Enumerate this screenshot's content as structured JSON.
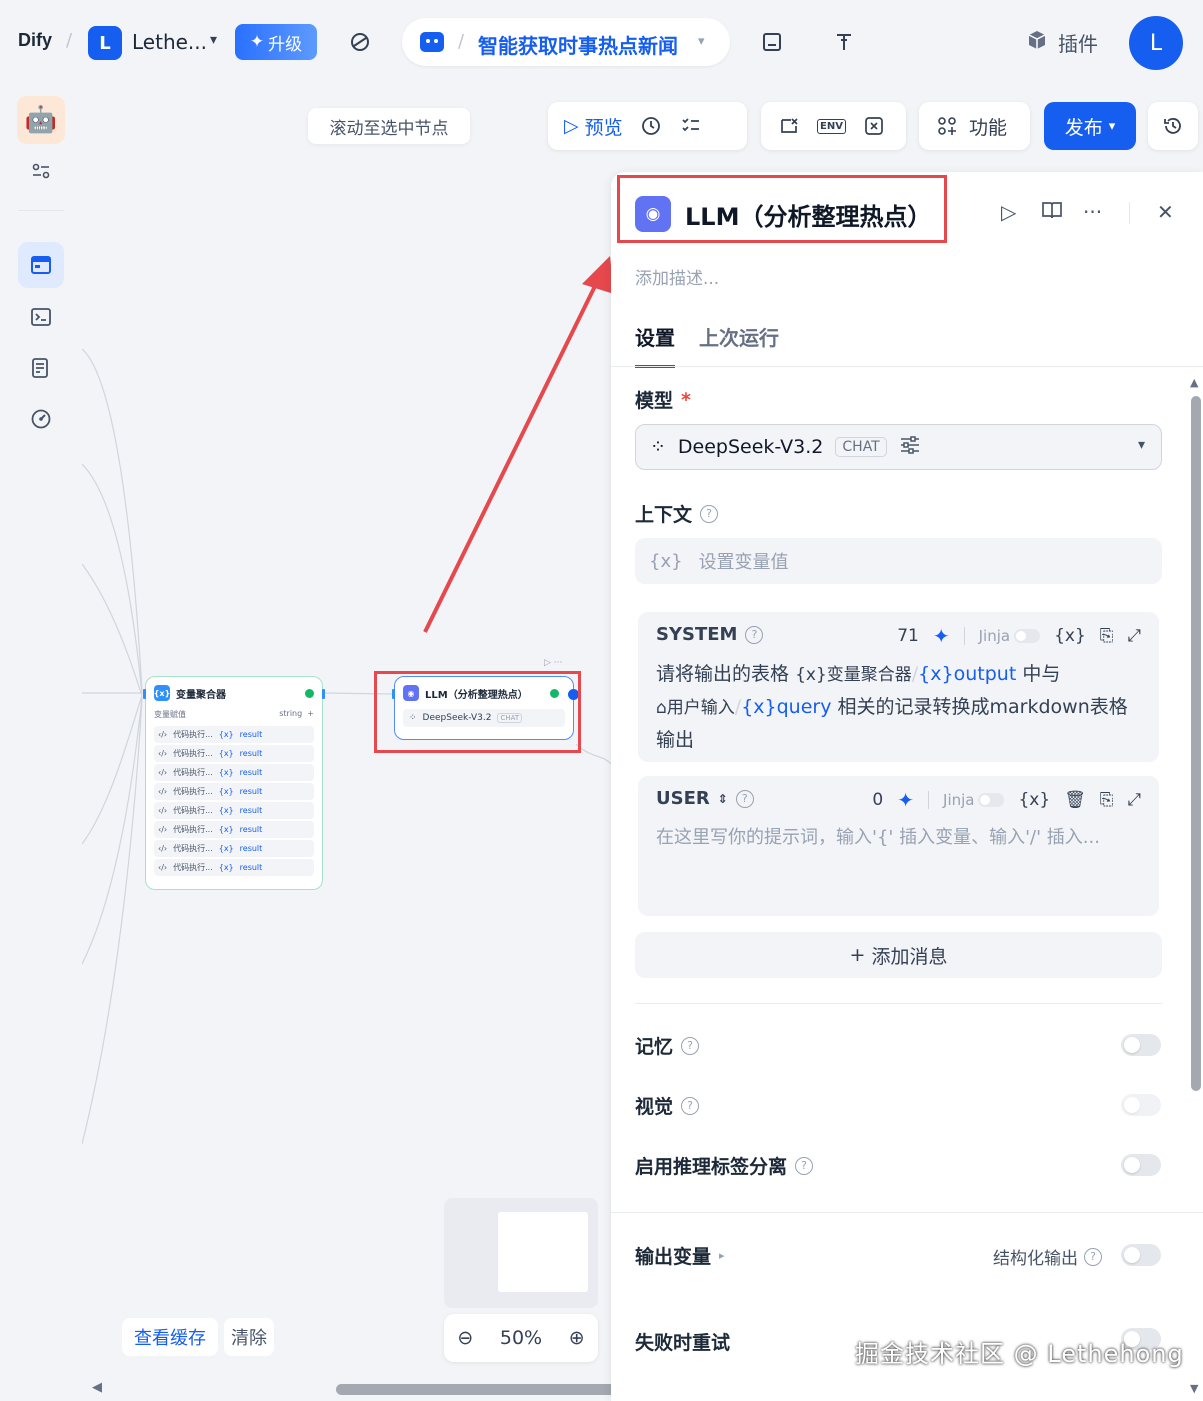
{
  "topbar": {
    "logo": "Dify",
    "workspace_initial": "L",
    "workspace_name": "Lethe...",
    "upgrade_label": "升级",
    "app_title": "智能获取时事热点新闻",
    "plugin_label": "插件",
    "user_initial": "L"
  },
  "canvas": {
    "scroll_to_node": "滚动至选中节点",
    "toolbar": {
      "preview_label": "预览",
      "features_label": "功能",
      "publish_label": "发布",
      "env_label": "ENV"
    },
    "view_cache": "查看缓存",
    "clear": "清除",
    "zoom_level": "50%"
  },
  "nodes": {
    "aggregator": {
      "title": "变量聚合器",
      "sub_label": "变量赋值",
      "sub_type": "string",
      "rows": [
        {
          "source": "代码执行...",
          "var": "result"
        },
        {
          "source": "代码执行...",
          "var": "result"
        },
        {
          "source": "代码执行...",
          "var": "result"
        },
        {
          "source": "代码执行...",
          "var": "result"
        },
        {
          "source": "代码执行...",
          "var": "result"
        },
        {
          "source": "代码执行...",
          "var": "result"
        },
        {
          "source": "代码执行...",
          "var": "result"
        },
        {
          "source": "代码执行...",
          "var": "result"
        }
      ]
    },
    "llm": {
      "title": "LLM（分析整理热点）",
      "model": "DeepSeek-V3.2",
      "model_badge": "CHAT"
    }
  },
  "panel": {
    "title": "LLM（分析整理热点）",
    "description_placeholder": "添加描述...",
    "tabs": [
      "设置",
      "上次运行"
    ],
    "model_label": "模型",
    "model_name": "DeepSeek-V3.2",
    "model_badge": "CHAT",
    "context_label": "上下文",
    "context_placeholder": "设置变量值",
    "system": {
      "role": "SYSTEM",
      "char_count": "71",
      "jinja_label": "Jinja",
      "text_1": "请将输出的表格",
      "var_1": "变量聚合器",
      "var_1_field": "output",
      "text_2": "中与",
      "var_2": "用户输入",
      "var_2_field": "query",
      "text_3": "相关的记录转换成markdown表格输出"
    },
    "user": {
      "role": "USER",
      "char_count": "0",
      "jinja_label": "Jinja",
      "placeholder": "在这里写你的提示词，输入'{' 插入变量、输入'/' 插入..."
    },
    "add_message": "添加消息",
    "memory_label": "记忆",
    "vision_label": "视觉",
    "reasoning_label": "启用推理标签分离",
    "output_vars_label": "输出变量",
    "structured_output_label": "结构化输出",
    "retry_label": "失败时重试"
  },
  "watermark": "掘金技术社区 @ Lethehong",
  "colors": {
    "accent": "#155eef",
    "annotation_red": "#e5484d"
  }
}
